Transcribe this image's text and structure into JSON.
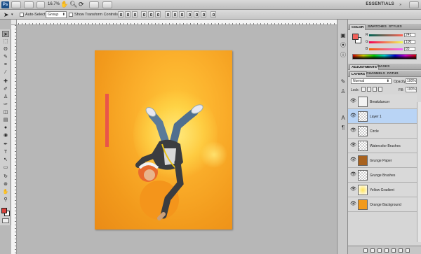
{
  "app": {
    "logo": "Ps",
    "zoom": "16.7%",
    "workspace": "ESSENTIALS"
  },
  "options": {
    "auto_select_label": "Auto-Select:",
    "auto_select_value": "Group",
    "show_transform_label": "Show Transform Controls"
  },
  "color_panel": {
    "tabs": [
      "COLOR",
      "SWATCHES",
      "STYLES"
    ],
    "foreground_color": "#f1605a",
    "channels": [
      {
        "label": "R",
        "value": "241"
      },
      {
        "label": "G",
        "value": "100"
      },
      {
        "label": "B",
        "value": "85"
      }
    ]
  },
  "adjust_panel": {
    "tabs": [
      "ADJUSTMENTS",
      "MASKS"
    ]
  },
  "layers_panel": {
    "tabs": [
      "LAYERS",
      "CHANNELS",
      "PATHS"
    ],
    "blend_mode": "Normal",
    "opacity_label": "Opacity:",
    "opacity_value": "100%",
    "lock_label": "Lock:",
    "fill_label": "Fill:",
    "fill_value": "100%",
    "layers": [
      {
        "name": "Breakdancer",
        "selected": false
      },
      {
        "name": "Layer 1",
        "selected": true
      },
      {
        "name": "Circle",
        "selected": false
      },
      {
        "name": "Watercolor Brushes",
        "selected": false
      },
      {
        "name": "Grunge Paper",
        "selected": false
      },
      {
        "name": "Grunge Brushes",
        "selected": false
      },
      {
        "name": "Yellow Gradient",
        "selected": false
      },
      {
        "name": "Orange Background",
        "selected": false
      }
    ]
  },
  "colors": {
    "accent_red": "#d9433d",
    "doc_orange": "#f29a1c",
    "selection_blue": "#b9d4f5"
  }
}
